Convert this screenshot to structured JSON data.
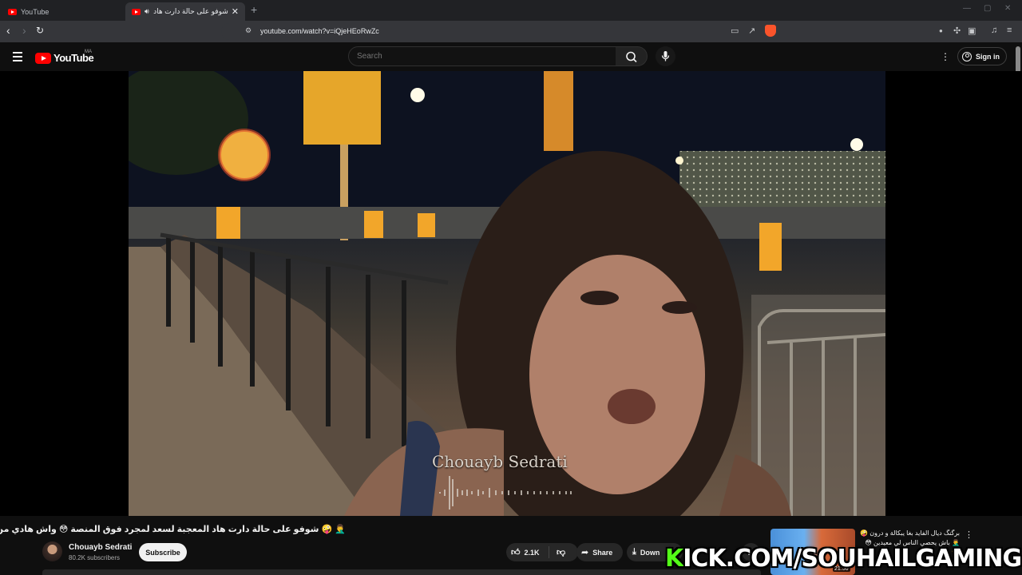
{
  "browser": {
    "tabs": [
      {
        "title": "YouTube",
        "active": false
      },
      {
        "title": "شوفو على حالة دارت هاد المع",
        "active": true
      }
    ],
    "new_tab": "+",
    "url": "youtube.com/watch?v=iQjeHEoRwZc"
  },
  "masthead": {
    "logo_text": "YouTube",
    "country_code": "MA",
    "search_placeholder": "Search",
    "sign_in": "Sign in"
  },
  "player": {
    "watermark": "Chouayb Sedrati"
  },
  "video": {
    "title": "🤦‍♂️ 🤪 شوفو على حالة دارت هاد المعجبة لسعد لمجرد فوق المنصة 😳 واش هادي من نيتها",
    "channel": "Chouayb Sedrati",
    "subscribers": "80.2K subscribers",
    "subscribe_label": "Subscribe",
    "likes": "2.1K",
    "share_label": "Share",
    "download_label": "Down",
    "more_label": "..."
  },
  "recommended": {
    "title": "برگنگ ديال الفايد بغا يبكالة و درون 🤪 🤦‍♂️ باش يحصي الناس لي معيدين 😳 🤷",
    "duration": "21:50"
  },
  "overlay": {
    "k": "K",
    "rest": "ICK.COM/SOUHAILGAMING"
  },
  "colors": {
    "yt_red": "#ff0000",
    "kick_green": "#53fc18",
    "brave_orange": "#fb542b"
  }
}
